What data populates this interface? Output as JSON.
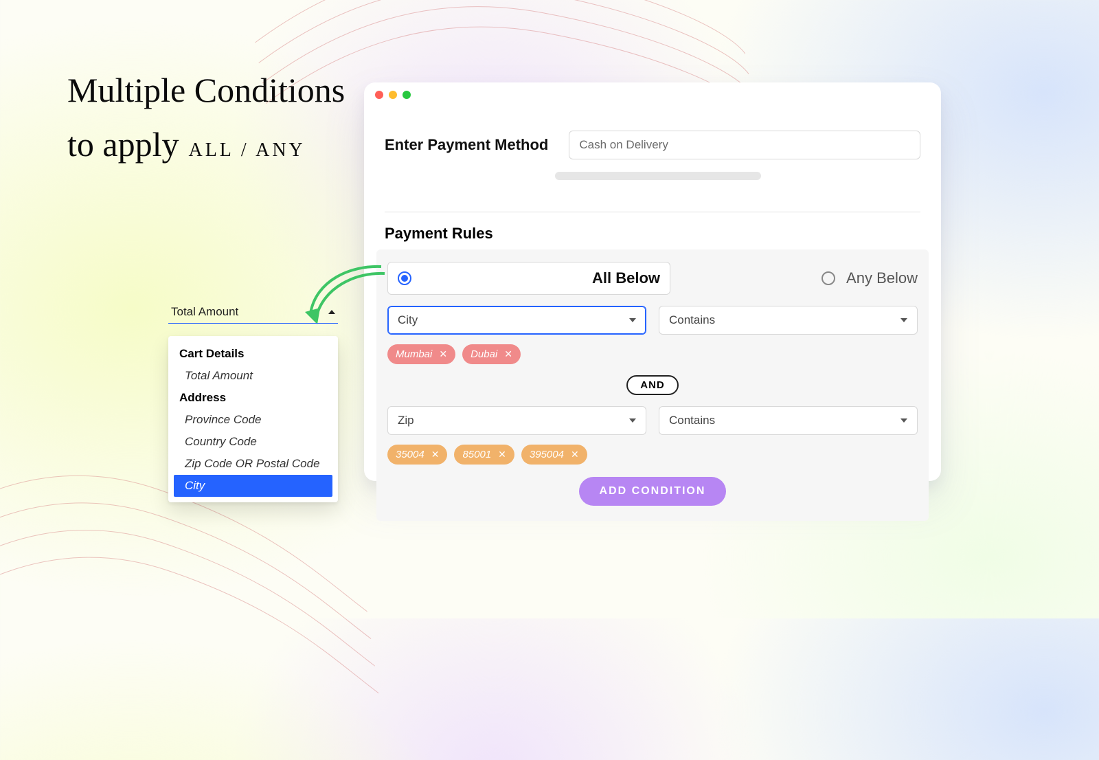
{
  "heading": {
    "line1": "Multiple Conditions",
    "line2": "to apply",
    "caps": "ALL / ANY"
  },
  "form": {
    "payment_label": "Enter Payment Method",
    "payment_value": "Cash on Delivery",
    "rules_title": "Payment Rules",
    "radio_all": "All Below",
    "radio_any": "Any Below",
    "cond1_field": "City",
    "cond1_op": "Contains",
    "cond1_tags": [
      "Mumbai",
      "Dubai"
    ],
    "and": "AND",
    "cond2_field": "Zip",
    "cond2_op": "Contains",
    "cond2_tags": [
      "35004",
      "85001",
      "395004"
    ],
    "add_btn": "ADD CONDITION"
  },
  "dropdown": {
    "trigger": "Total Amount",
    "group1": "Cart Details",
    "g1_items": [
      "Total Amount"
    ],
    "group2": "Address",
    "g2_items": {
      "0": "Province Code",
      "1": "Country Code",
      "2": "Zip Code OR Postal Code",
      "3": "City"
    }
  }
}
